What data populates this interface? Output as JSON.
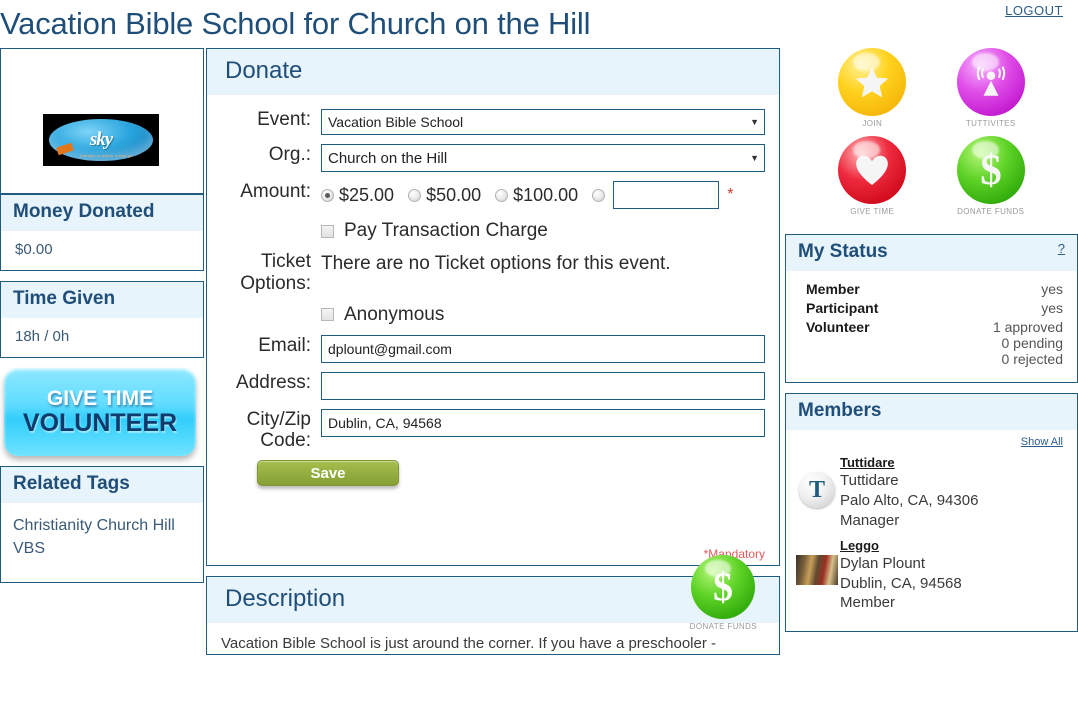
{
  "header": {
    "title": "Vacation Bible School for Church on the Hill",
    "logout": "LOGOUT"
  },
  "left": {
    "logo_text": "sky",
    "logo_sub": "freedom is where u may go",
    "money": {
      "title": "Money Donated",
      "value": "$0.00"
    },
    "time": {
      "title": "Time Given",
      "value": "18h / 0h"
    },
    "volunteer_button": {
      "line1": "GIVE TIME",
      "line2": "VOLUNTEER"
    },
    "tags": {
      "title": "Related Tags",
      "value": "Christianity Church Hill VBS"
    }
  },
  "donate": {
    "panel_title": "Donate",
    "event_label": "Event:",
    "event_value": "Vacation Bible School",
    "org_label": "Org.:",
    "org_value": "Church on the Hill",
    "amount_label": "Amount:",
    "amount_options": [
      "$25.00",
      "$50.00",
      "$100.00"
    ],
    "amount_selected_index": 0,
    "amount_custom_value": "",
    "pay_charge_label": "Pay Transaction Charge",
    "pay_charge_checked": false,
    "ticket_label": "Ticket Options:",
    "ticket_note": "There are no Ticket options for this event.",
    "anonymous_label": "Anonymous",
    "anonymous_checked": false,
    "email_label": "Email:",
    "email_value": "dplount@gmail.com",
    "address_label": "Address:",
    "address_value": "",
    "city_label": "City/Zip Code:",
    "city_value": "Dublin, CA, 94568",
    "mandatory_note": "*Mandatory",
    "save_label": "Save",
    "side_icon_caption": "DONATE FUNDS",
    "required_mark": "*"
  },
  "description": {
    "panel_title": "Description",
    "text": "Vacation Bible School is just around the corner. If you have a preschooler -"
  },
  "right": {
    "icons": [
      {
        "caption": "JOIN",
        "color": "#ffd21e",
        "glyph": "star"
      },
      {
        "caption": "TUTTIVITES",
        "color": "#e04fe8",
        "glyph": "broadcast"
      },
      {
        "caption": "GIVE TIME",
        "color": "#ee2a3e",
        "glyph": "heart"
      },
      {
        "caption": "DONATE FUNDS",
        "color": "#5fd327",
        "glyph": "dollar"
      }
    ],
    "status": {
      "title": "My Status",
      "help": "?",
      "rows": [
        {
          "key": "Member",
          "value": "yes"
        },
        {
          "key": "Participant",
          "value": "yes"
        },
        {
          "key": "Volunteer",
          "value": "1 approved\n0 pending\n0 rejected"
        }
      ]
    },
    "members": {
      "title": "Members",
      "show_all": "Show All",
      "list": [
        {
          "handle": "Tuttidare",
          "name": "Tuttidare",
          "location": "Palo Alto, CA, 94306",
          "role": "Manager",
          "avatar_letter": "T",
          "avatar_type": "letter"
        },
        {
          "handle": "Leggo",
          "name": "Dylan Plount",
          "location": "Dublin, CA, 94568",
          "role": "Member",
          "avatar_letter": "",
          "avatar_type": "photo"
        }
      ]
    }
  }
}
